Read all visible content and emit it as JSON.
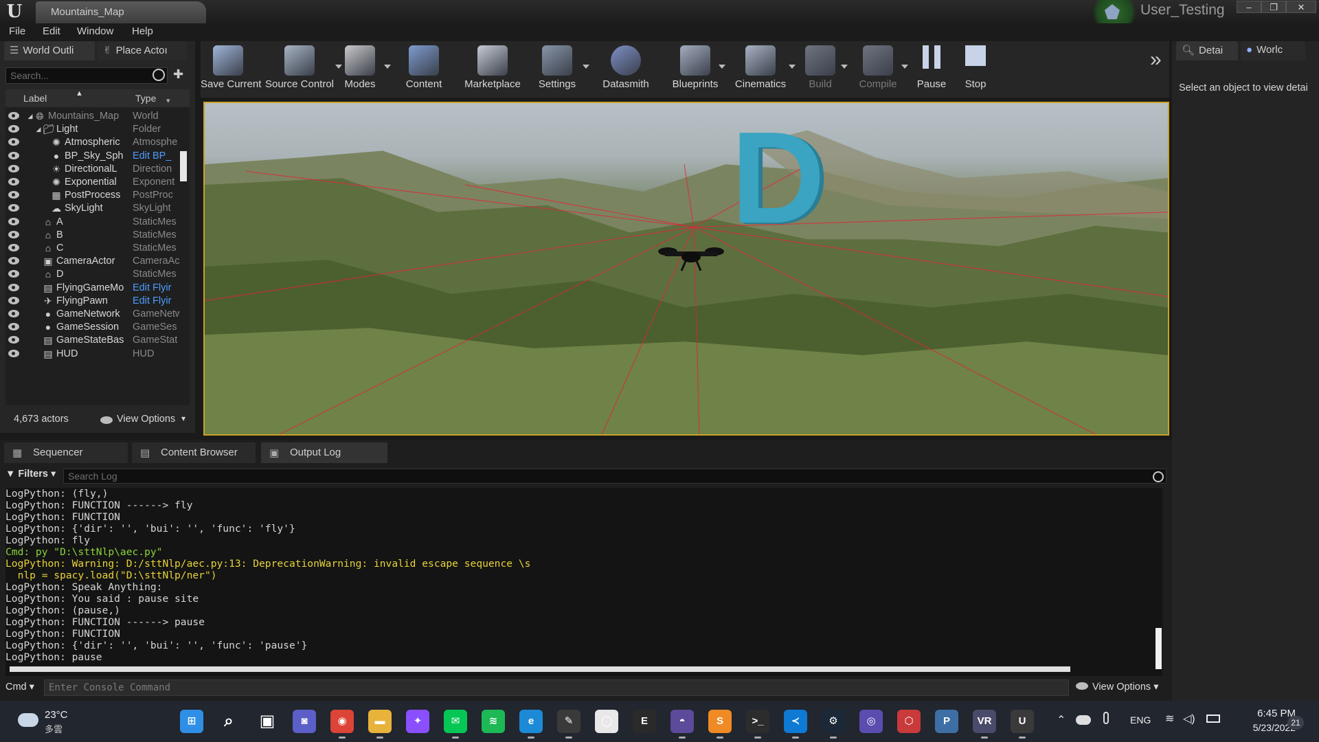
{
  "window": {
    "document_tab": "Mountains_Map",
    "user": "User_Testing",
    "controls": {
      "minimize": "–",
      "restore": "❐",
      "close": "✕"
    }
  },
  "menu": [
    "File",
    "Edit",
    "Window",
    "Help"
  ],
  "left_tabs": {
    "outliner": "World Outli",
    "place": "Place Actoı"
  },
  "outliner": {
    "search_placeholder": "Search...",
    "col_label": "Label",
    "col_type": "Type",
    "rows": [
      {
        "label": "Mountains_Map",
        "type": "World",
        "indent": 0
      },
      {
        "label": "Light",
        "type": "Folder",
        "indent": 1
      },
      {
        "label": "Atmospheric",
        "type": "Atmosphe",
        "indent": 2
      },
      {
        "label": "BP_Sky_Sph",
        "type": "Edit BP_",
        "indent": 2,
        "link": true
      },
      {
        "label": "DirectionalL",
        "type": "Direction",
        "indent": 2
      },
      {
        "label": "Exponential",
        "type": "Exponent",
        "indent": 2
      },
      {
        "label": "PostProcess",
        "type": "PostProc",
        "indent": 2
      },
      {
        "label": "SkyLight",
        "type": "SkyLight",
        "indent": 2
      },
      {
        "label": "A",
        "type": "StaticMes",
        "indent": 1
      },
      {
        "label": "B",
        "type": "StaticMes",
        "indent": 1
      },
      {
        "label": "C",
        "type": "StaticMes",
        "indent": 1
      },
      {
        "label": "CameraActor",
        "type": "CameraAc",
        "indent": 1
      },
      {
        "label": "D",
        "type": "StaticMes",
        "indent": 1
      },
      {
        "label": "FlyingGameMo",
        "type": "Edit Flyir",
        "indent": 1,
        "link": true
      },
      {
        "label": "FlyingPawn",
        "type": "Edit Flyir",
        "indent": 1,
        "link": true
      },
      {
        "label": "GameNetwork",
        "type": "GameNetw",
        "indent": 1
      },
      {
        "label": "GameSession",
        "type": "GameSes",
        "indent": 1
      },
      {
        "label": "GameStateBas",
        "type": "GameStat",
        "indent": 1
      },
      {
        "label": "HUD",
        "type": "HUD",
        "indent": 1
      }
    ],
    "actor_count": "4,673 actors",
    "view_options": "View Options"
  },
  "toolbar": [
    {
      "label": "Save Current",
      "icon": "save-icon",
      "color": "#9fb6d8"
    },
    {
      "label": "Source Control",
      "icon": "source-control-icon",
      "color": "#a7b4c4"
    },
    {
      "label": "Modes",
      "icon": "modes-icon",
      "color": "#c9c9c9"
    },
    {
      "label": "Content",
      "icon": "content-icon",
      "color": "#7e9ccf"
    },
    {
      "label": "Marketplace",
      "icon": "marketplace-icon",
      "color": "#c7cbd4"
    },
    {
      "label": "Settings",
      "icon": "settings-icon",
      "color": "#8895a8"
    },
    {
      "label": "Datasmith",
      "icon": "datasmith-icon",
      "color": "#7d8fc7"
    },
    {
      "label": "Blueprints",
      "icon": "blueprints-icon",
      "color": "#a4adbf"
    },
    {
      "label": "Cinematics",
      "icon": "cinematics-icon",
      "color": "#a9b2c4"
    },
    {
      "label": "Build",
      "icon": "build-icon",
      "color": "#6f7480"
    },
    {
      "label": "Compile",
      "icon": "compile-icon",
      "color": "#6f7480"
    },
    {
      "label": "Pause",
      "icon": "pause-icon",
      "color": "#c8d3e8"
    },
    {
      "label": "Stop",
      "icon": "stop-icon",
      "color": "#c8d3e8"
    }
  ],
  "toolbar_more": "»",
  "viewport": {
    "letter": "D"
  },
  "right_panel": {
    "tab_details": "Detai",
    "tab_world": "Worlc",
    "message": "Select an object to view detai"
  },
  "bottom_tabs": [
    "Sequencer",
    "Content Browser",
    "Output Log"
  ],
  "output_log": {
    "filters": "Filters",
    "search_placeholder": "Search Log",
    "lines": [
      {
        "text": "LogPython: (fly,)",
        "kind": "normal"
      },
      {
        "text": "LogPython: FUNCTION ------> fly",
        "kind": "normal"
      },
      {
        "text": "LogPython: FUNCTION",
        "kind": "normal"
      },
      {
        "text": "LogPython: {'dir': '', 'bui': '', 'func': 'fly'}",
        "kind": "normal"
      },
      {
        "text": "LogPython: fly",
        "kind": "normal"
      },
      {
        "text": "Cmd: py \"D:\\sttNlp\\aec.py\"",
        "kind": "cmd"
      },
      {
        "text": "LogPython: Warning: D:/sttNlp/aec.py:13: DeprecationWarning: invalid escape sequence \\s",
        "kind": "warn"
      },
      {
        "text": "  nlp = spacy.load(\"D:\\sttNlp/ner\")",
        "kind": "warn"
      },
      {
        "text": "LogPython: Speak Anything:",
        "kind": "normal"
      },
      {
        "text": "LogPython: You said : pause site",
        "kind": "normal"
      },
      {
        "text": "LogPython: (pause,)",
        "kind": "normal"
      },
      {
        "text": "LogPython: FUNCTION ------> pause",
        "kind": "normal"
      },
      {
        "text": "LogPython: FUNCTION",
        "kind": "normal"
      },
      {
        "text": "LogPython: {'dir': '', 'bui': '', 'func': 'pause'}",
        "kind": "normal"
      },
      {
        "text": "LogPython: pause",
        "kind": "normal"
      }
    ],
    "cmd_label": "Cmd",
    "console_placeholder": "Enter Console Command",
    "view_options": "View Options"
  },
  "taskbar": {
    "weather_temp": "23°C",
    "weather_desc": "多雲",
    "apps": [
      {
        "name": "start-icon",
        "glyph": "⊞",
        "color": "#2f8fe6"
      },
      {
        "name": "search-icon",
        "glyph": "⌕",
        "color": "#21262f"
      },
      {
        "name": "task-view-icon",
        "glyph": "▣",
        "color": "#21262f"
      },
      {
        "name": "teams-chat-icon",
        "glyph": "◙",
        "color": "#5b5fc7"
      },
      {
        "name": "chrome-icon",
        "glyph": "◉",
        "color": "#db4437"
      },
      {
        "name": "file-explorer-icon",
        "glyph": "▬",
        "color": "#e8b33a"
      },
      {
        "name": "messenger-icon",
        "glyph": "✦",
        "color": "#8a4fff"
      },
      {
        "name": "line-icon",
        "glyph": "✉",
        "color": "#06c755"
      },
      {
        "name": "spotify-icon",
        "glyph": "≋",
        "color": "#1db954"
      },
      {
        "name": "edge-icon",
        "glyph": "e",
        "color": "#1c8ad6"
      },
      {
        "name": "inkscape-icon",
        "glyph": "✎",
        "color": "#3a3a3a"
      },
      {
        "name": "oculus-icon",
        "glyph": "◯",
        "color": "#e8e8e8"
      },
      {
        "name": "epic-games-icon",
        "glyph": "E",
        "color": "#2a2a2a"
      },
      {
        "name": "oculus-app-icon",
        "glyph": "◓",
        "color": "#5c4a9a"
      },
      {
        "name": "sublime-icon",
        "glyph": "S",
        "color": "#f08a24"
      },
      {
        "name": "terminal-icon",
        "glyph": ">_",
        "color": "#2c2c2c"
      },
      {
        "name": "vscode-icon",
        "glyph": "≺",
        "color": "#0e7ad3"
      },
      {
        "name": "steam-icon",
        "glyph": "⚙",
        "color": "#1b2838"
      },
      {
        "name": "github-icon",
        "glyph": "◎",
        "color": "#5b4cb0"
      },
      {
        "name": "dice-icon",
        "glyph": "⬡",
        "color": "#c93a3a"
      },
      {
        "name": "python-icon",
        "glyph": "P",
        "color": "#3d6fa5"
      },
      {
        "name": "vr-icon",
        "glyph": "VR",
        "color": "#4a4a6a"
      },
      {
        "name": "unreal-icon",
        "glyph": "U",
        "color": "#3a3a3a"
      }
    ],
    "tray": {
      "lang": "ENG"
    },
    "time": "6:45 PM",
    "date": "5/23/2022",
    "notifications": "21"
  }
}
